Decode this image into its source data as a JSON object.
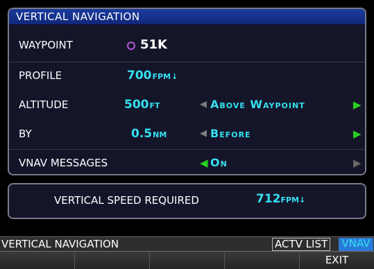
{
  "panel": {
    "title": "VERTICAL NAVIGATION",
    "waypoint": {
      "label": "WAYPOINT",
      "id": "51K"
    },
    "profile": {
      "label": "PROFILE",
      "value": "700",
      "unit": "FPM",
      "trend": "↓"
    },
    "altitude": {
      "label": "ALTITUDE",
      "value": "500",
      "unit": "FT",
      "selection": "Above Waypoint"
    },
    "by": {
      "label": "BY",
      "value": "0.5",
      "unit": "NM",
      "selection": "Before"
    },
    "messages": {
      "label": "VNAV MESSAGES",
      "selection": "On"
    }
  },
  "vsr": {
    "label": "VERTICAL SPEED REQUIRED",
    "value": "712",
    "unit": "FPM",
    "trend": "↓"
  },
  "status": {
    "title": "VERTICAL NAVIGATION",
    "tab_actv": "ACTV LIST",
    "tab_vnav": "VNAV"
  },
  "softkeys": [
    "",
    "",
    "",
    "",
    "EXIT"
  ],
  "icons": {
    "waypoint_marker": "circle-icon",
    "left_arrow": "triangle-left-icon",
    "right_arrow": "triangle-right-icon"
  },
  "colors": {
    "cyan": "#35e0f0",
    "green": "#29d020",
    "magenta": "#b15ad6",
    "title_bar": "#1a3b9e"
  }
}
